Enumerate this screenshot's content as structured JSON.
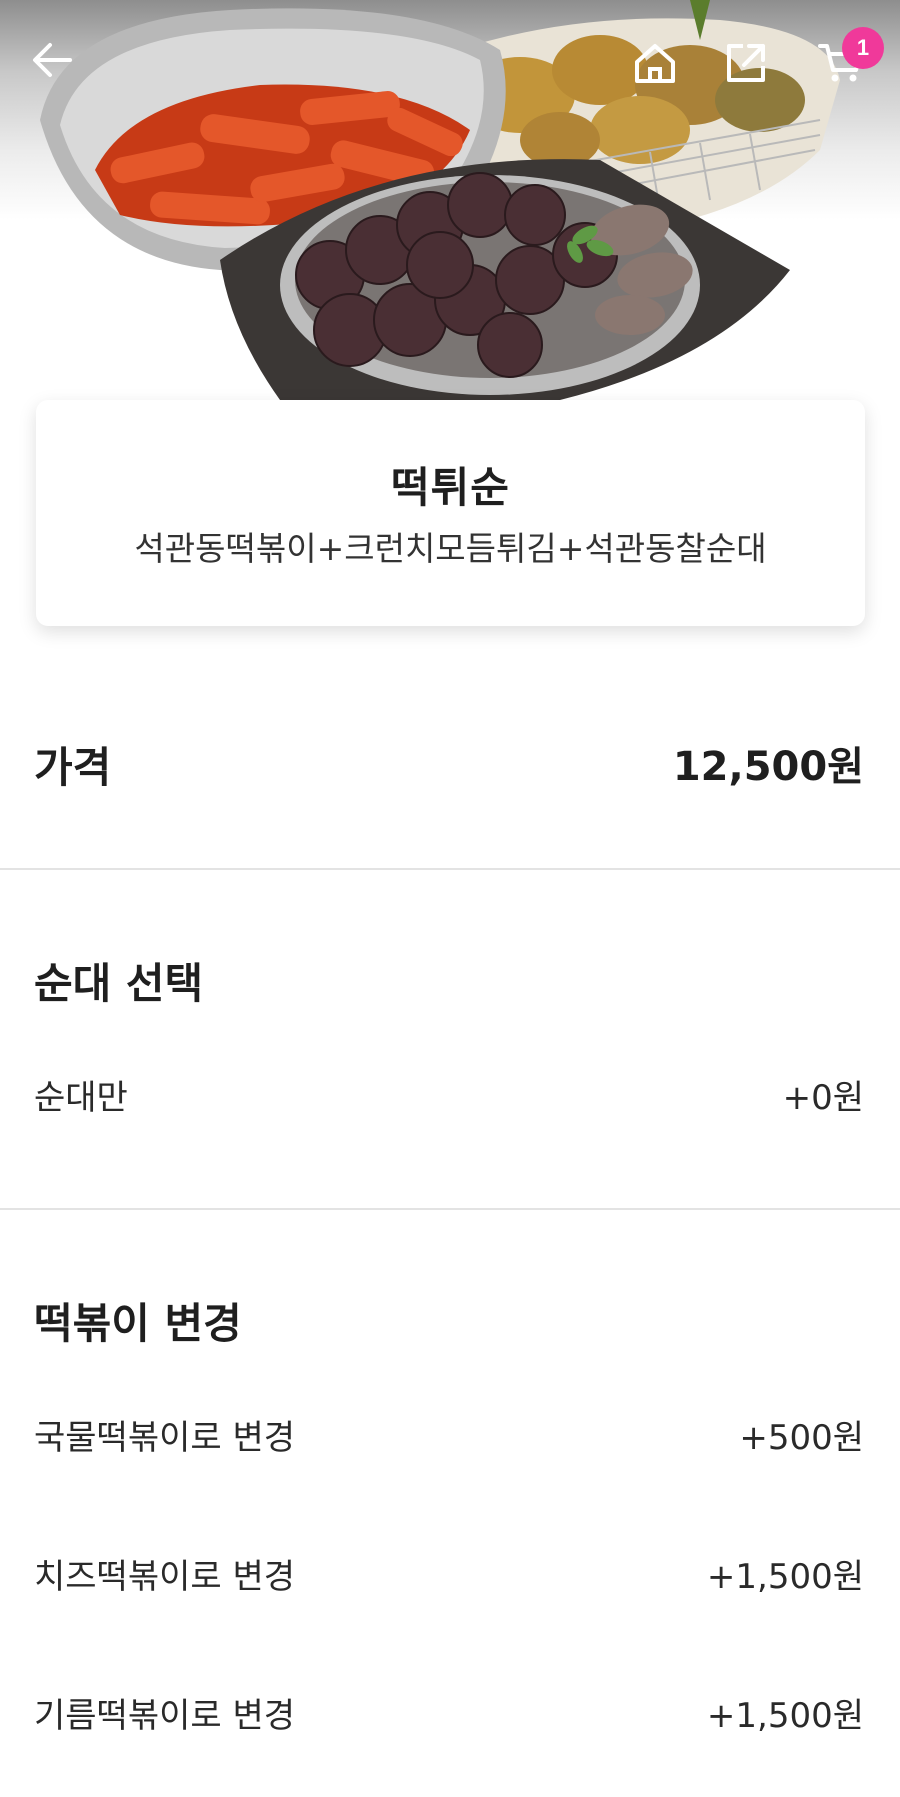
{
  "header": {
    "back_icon": "arrow-left-icon",
    "home_icon": "home-icon",
    "share_icon": "share-icon",
    "cart_icon": "cart-icon",
    "cart_badge": "1",
    "accent_color": "#f0399a"
  },
  "product": {
    "name": "떡튀순",
    "description": "석관동떡볶이+크런치모듬튀김+석관동찰순대"
  },
  "price": {
    "label": "가격",
    "value": "12,500원"
  },
  "sections": [
    {
      "title": "순대 선택",
      "options": [
        {
          "label": "순대만",
          "price": "+0원"
        }
      ]
    },
    {
      "title": "떡볶이 변경",
      "options": [
        {
          "label": "국물떡볶이로 변경",
          "price": "+500원"
        },
        {
          "label": "치즈떡볶이로 변경",
          "price": "+1,500원"
        },
        {
          "label": "기름떡볶이로 변경",
          "price": "+1,500원"
        }
      ]
    }
  ]
}
